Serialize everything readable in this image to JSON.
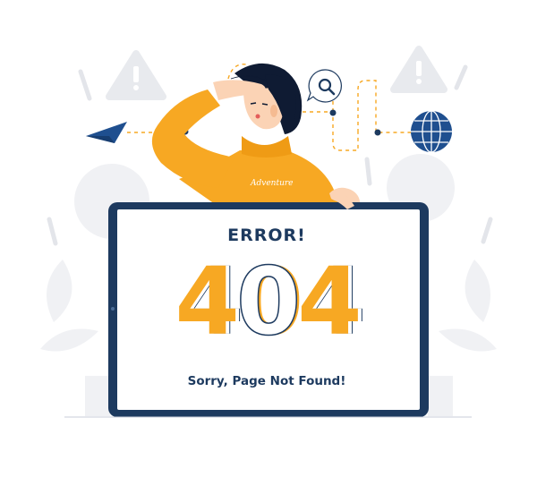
{
  "illustration": {
    "error_label": "ERROR!",
    "code_digits": [
      "4",
      "0",
      "4"
    ],
    "message": "Sorry, Page Not Found!",
    "shirt_text": "Adventure"
  },
  "icons": {
    "warning": "warning-triangle-icon",
    "search": "magnifier-icon",
    "globe": "globe-icon",
    "plane": "paper-plane-icon",
    "gear": "gear-icon"
  },
  "colors": {
    "accent": "#f7a823",
    "navy": "#1d3a5f",
    "background_shapes": "#f0f1f4",
    "blue": "#1f4f8f"
  }
}
